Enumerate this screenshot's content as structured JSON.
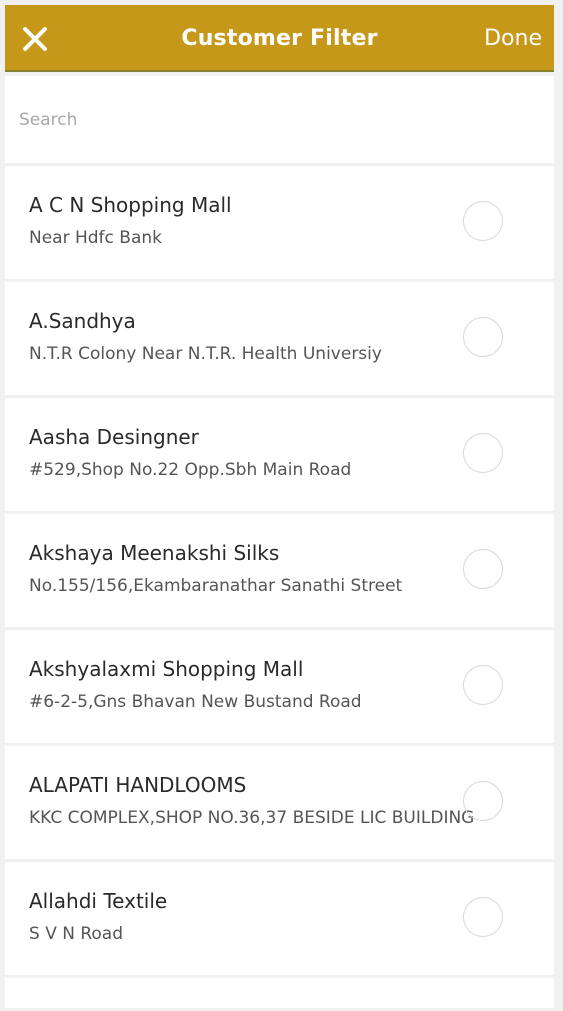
{
  "header": {
    "title": "Customer Filter",
    "done_label": "Done",
    "close_icon": "close-icon",
    "background_color": "#c6981a"
  },
  "search": {
    "placeholder": "Search",
    "value": ""
  },
  "customers": [
    {
      "name": "A C N Shopping Mall",
      "address": "Near Hdfc Bank",
      "selected": false
    },
    {
      "name": "A.Sandhya",
      "address": "N.T.R Colony Near N.T.R. Health Universiy",
      "selected": false
    },
    {
      "name": "Aasha Desingner",
      "address": "#529,Shop No.22 Opp.Sbh Main Road",
      "selected": false
    },
    {
      "name": "Akshaya Meenakshi Silks",
      "address": "No.155/156,Ekambaranathar Sanathi Street",
      "selected": false
    },
    {
      "name": "Akshyalaxmi Shopping Mall",
      "address": "#6-2-5,Gns Bhavan New Bustand Road",
      "selected": false
    },
    {
      "name": "ALAPATI HANDLOOMS",
      "address": "KKC COMPLEX,SHOP NO.36,37 BESIDE LIC BUILDING",
      "selected": false
    },
    {
      "name": "Allahdi Textile",
      "address": "S V N Road",
      "selected": false
    }
  ]
}
